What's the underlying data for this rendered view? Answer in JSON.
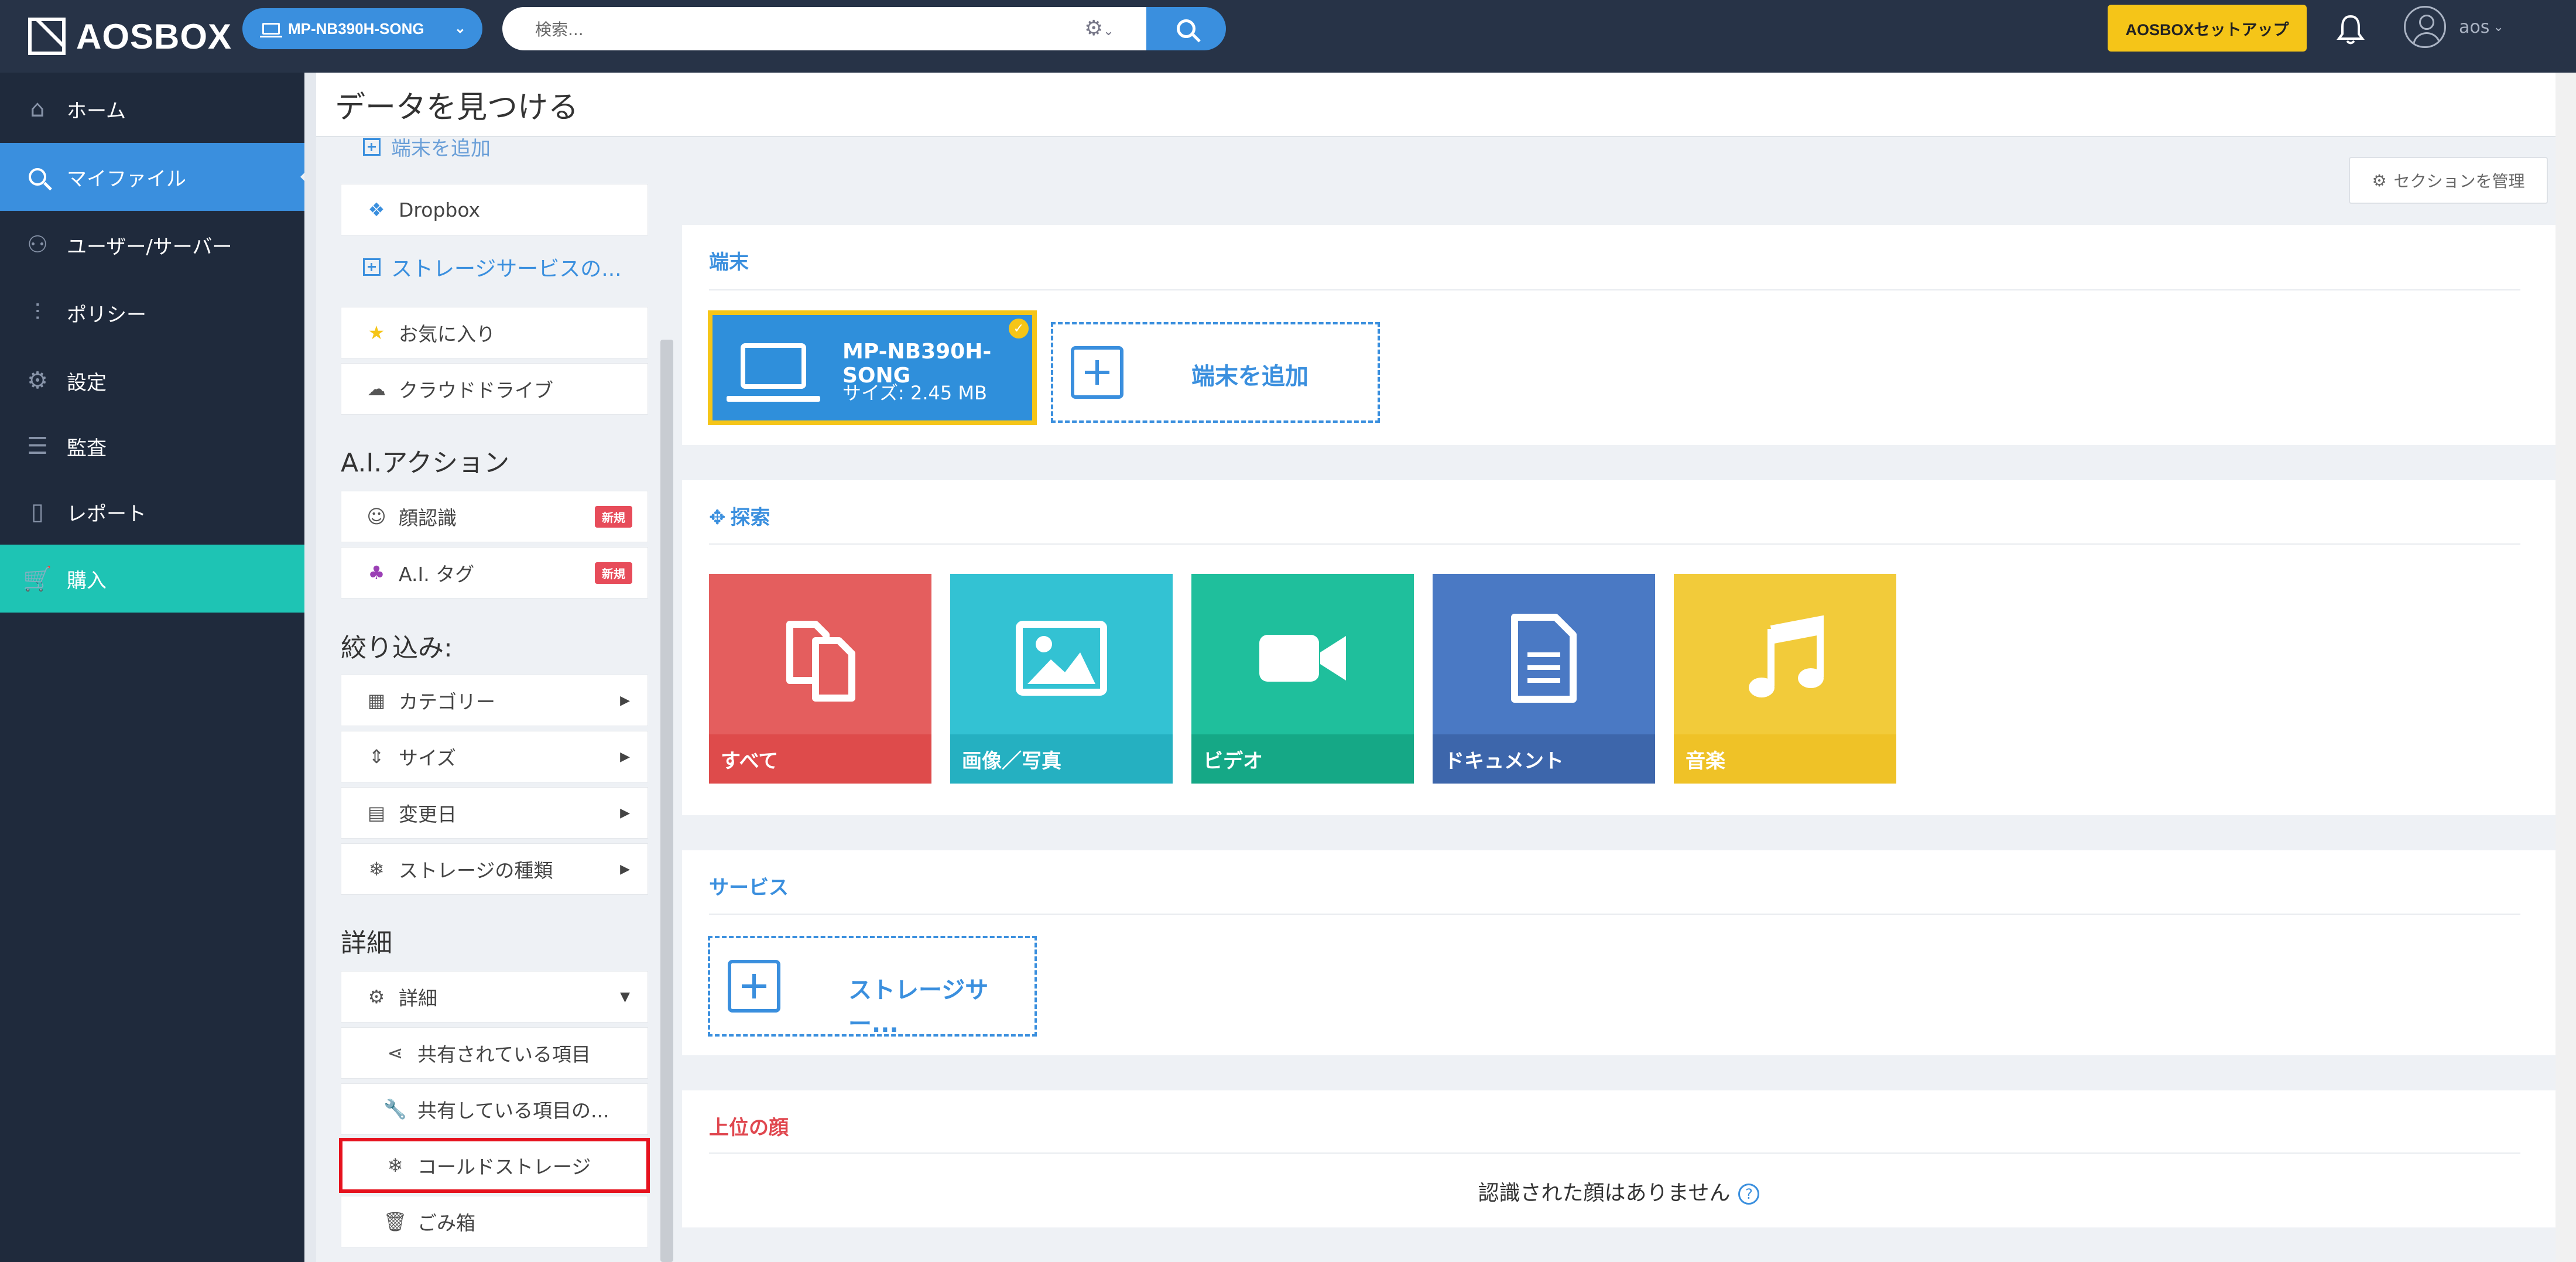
{
  "app": {
    "logo_text": "AOSBOX"
  },
  "topbar": {
    "device_selector": "MP-NB390H-SONG",
    "search_placeholder": "検索...",
    "setup_button": "AOSBOXセットアップ",
    "username": "aos"
  },
  "nav": {
    "items": [
      {
        "label": "ホーム",
        "icon": "home-icon"
      },
      {
        "label": "マイファイル",
        "icon": "search-icon"
      },
      {
        "label": "ユーザー/サーバー",
        "icon": "users-icon"
      },
      {
        "label": "ポリシー",
        "icon": "sliders-icon"
      },
      {
        "label": "設定",
        "icon": "gear-icon"
      },
      {
        "label": "監査",
        "icon": "list-icon"
      },
      {
        "label": "レポート",
        "icon": "bar-chart-icon"
      },
      {
        "label": "購入",
        "icon": "cart-icon"
      }
    ]
  },
  "page": {
    "title": "データを見つける"
  },
  "filters": {
    "add_device_link": "端末を追加",
    "dropbox": "Dropbox",
    "add_storage_link": "ストレージサービスの...",
    "favorites": "お気に入り",
    "cloud_drive": "クラウドドライブ",
    "ai_heading": "A.I.アクション",
    "face_recognition": "顔認識",
    "ai_tag": "A.I. タグ",
    "new_badge": "新規",
    "narrow_heading": "絞り込み:",
    "category": "カテゴリー",
    "size": "サイズ",
    "modified_date": "変更日",
    "storage_type": "ストレージの種類",
    "details_heading": "詳細",
    "details": "詳細",
    "shared_items": "共有されている項目",
    "sharing_items": "共有している項目の...",
    "cold_storage": "コールドストレージ",
    "trash": "ごみ箱"
  },
  "content": {
    "manage_sections": "セクションを管理",
    "devices": {
      "title": "端末",
      "device_name": "MP-NB390H-SONG",
      "device_size": "サイズ: 2.45 MB",
      "add_device": "端末を追加"
    },
    "explore": {
      "title": "探索",
      "tiles": [
        {
          "label": "すべて",
          "color": "#e45e5e",
          "band": "#de4b4b"
        },
        {
          "label": "画像／写真",
          "color": "#33c2d3",
          "band": "#25b0c1"
        },
        {
          "label": "ビデオ",
          "color": "#1fbf9c",
          "band": "#15a886"
        },
        {
          "label": "ドキュメント",
          "color": "#4a79c4",
          "band": "#3d66ab"
        },
        {
          "label": "音楽",
          "color": "#f2cb3a",
          "band": "#efc227"
        }
      ]
    },
    "services": {
      "title": "サービス",
      "add_storage": "ストレージサー..."
    },
    "faces": {
      "title": "上位の顔",
      "empty_message": "認識された顔はありません"
    }
  },
  "colors": {
    "accent": "#3a8fde",
    "topbar": "#273347",
    "sidebar": "#1f2a3c",
    "buy": "#1ec4b4",
    "setup": "#f5c518",
    "faces_title": "#e0474f"
  }
}
